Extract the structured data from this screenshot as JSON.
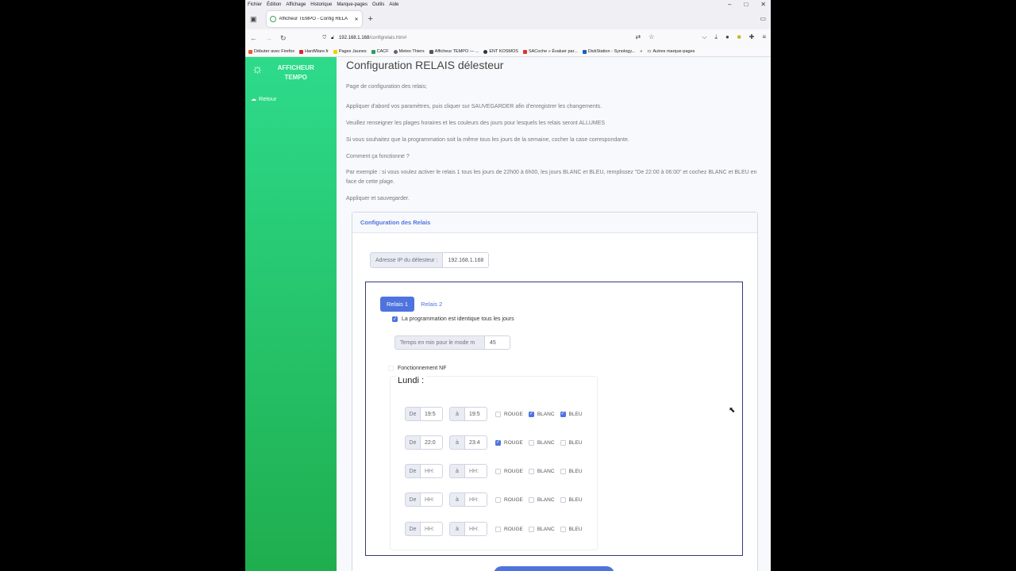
{
  "browser": {
    "menu": [
      "Fichier",
      "Édition",
      "Affichage",
      "Historique",
      "Marque-pages",
      "Outils",
      "Aide"
    ],
    "tab_title": "Afficheur TEMPO - Config RELA",
    "url_host": "192.168.1.168",
    "url_path": "/configrelais.htm#",
    "bookmarks": [
      "Débuter avec Firefox",
      "HardWare.fr",
      "Pages Jaunes",
      "CACF",
      "Meteo Thiers",
      "Afficheur TEMPO — ...",
      "ENT KOSMOS",
      "SACoche » Évaluer par...",
      "DiskStation - Synology...",
      "Autres marque-pages"
    ]
  },
  "sidebar": {
    "brand": "AFFICHEUR TEMPO",
    "back_label": "Retour"
  },
  "page": {
    "title": "Configuration RELAIS délesteur",
    "paragraphs": [
      "Page de configuration des relais;",
      "Appliquer d'abord vos paramètres, puis cliquer sur SAUVEGARDER afin d'enregistrer les changements.",
      "Veuillez renseigner les plages horaires et les couleurs des jours pour lesquels les relais seront ALLUMES",
      "Si vous souhaitez que la programmation soit la même tous les jours de la semaine, cocher la case correspondante.",
      "Comment ça fonctionne ?",
      "Par exemple : si vous voulez activer le relais 1 tous les jours de 22h00 à 6h00, les jours BLANC et BLEU, remplissez \"De 22:00 à 06:00\" et cochez BLANC et BLEU en face de cette plage.",
      "Appliquer et sauvegarder."
    ]
  },
  "card": {
    "header": "Configuration des Relais",
    "ip_label": "Adresse IP du délesteur :",
    "ip_value": "192.168.1.168"
  },
  "relais": {
    "tabs": [
      "Relais 1",
      "Relais 2"
    ],
    "same_program_label": "La programmation est identique tous les jours",
    "temp_label": "Temps en min pour le mode m",
    "temp_value": "45",
    "nf_label": "Fonctionnement NF",
    "day_label": "Lundi :",
    "from_label": "De",
    "to_label": "à",
    "color_labels": [
      "ROUGE",
      "BLANC",
      "BLEU"
    ],
    "slots": [
      {
        "from": "19:5",
        "to": "19:5",
        "rouge": false,
        "blanc": true,
        "bleu": true
      },
      {
        "from": "22:0",
        "to": "23:4",
        "rouge": true,
        "blanc": false,
        "bleu": false
      },
      {
        "from": "HH:",
        "to": "HH:",
        "rouge": false,
        "blanc": false,
        "bleu": false
      },
      {
        "from": "HH:",
        "to": "HH:",
        "rouge": false,
        "blanc": false,
        "bleu": false
      },
      {
        "from": "HH:",
        "to": "HH:",
        "rouge": false,
        "blanc": false,
        "bleu": false
      }
    ]
  },
  "colors": {
    "sidebar_top": "#2ddb8b",
    "sidebar_bottom": "#1fae4e",
    "primary": "#4e73df"
  }
}
